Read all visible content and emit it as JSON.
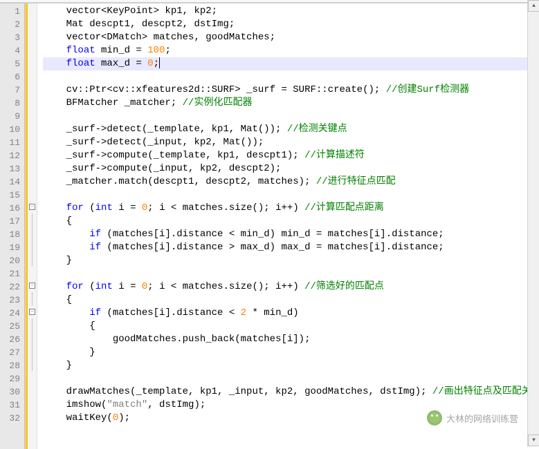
{
  "lineCount": 32,
  "currentLine": 5,
  "foldMarkers": {
    "16": "minus",
    "22": "minus",
    "24": "minus"
  },
  "foldLines": [
    17,
    18,
    19,
    20,
    23,
    25,
    26,
    27,
    28
  ],
  "code": {
    "l1": {
      "indent": "    ",
      "tokens": [
        [
          "t",
          "vector<KeyPoint> kp1, kp2;"
        ]
      ]
    },
    "l2": {
      "indent": "    ",
      "tokens": [
        [
          "t",
          "Mat descpt1, descpt2, dstImg;"
        ]
      ]
    },
    "l3": {
      "indent": "    ",
      "tokens": [
        [
          "t",
          "vector<DMatch> matches, goodMatches;"
        ]
      ]
    },
    "l4": {
      "indent": "    ",
      "tokens": [
        [
          "k",
          "float"
        ],
        [
          "t",
          " min_d = "
        ],
        [
          "n",
          "100"
        ],
        [
          "t",
          ";"
        ]
      ]
    },
    "l5": {
      "indent": "    ",
      "tokens": [
        [
          "k",
          "float"
        ],
        [
          "t",
          " max_d = "
        ],
        [
          "n",
          "0"
        ],
        [
          "t",
          ";"
        ]
      ],
      "cursor": true
    },
    "l6": {
      "indent": "",
      "tokens": []
    },
    "l7": {
      "indent": "    ",
      "tokens": [
        [
          "t",
          "cv::Ptr<cv::xfeatures2d::SURF> _surf = SURF::create(); "
        ],
        [
          "c",
          "//创建Surf检测器"
        ]
      ]
    },
    "l8": {
      "indent": "    ",
      "tokens": [
        [
          "t",
          "BFMatcher _matcher; "
        ],
        [
          "c",
          "//实例化匹配器"
        ]
      ]
    },
    "l9": {
      "indent": "",
      "tokens": []
    },
    "l10": {
      "indent": "    ",
      "tokens": [
        [
          "t",
          "_surf->detect(_template, kp1, Mat()); "
        ],
        [
          "c",
          "//检测关键点"
        ]
      ]
    },
    "l11": {
      "indent": "    ",
      "tokens": [
        [
          "t",
          "_surf->detect(_input, kp2, Mat());"
        ]
      ]
    },
    "l12": {
      "indent": "    ",
      "tokens": [
        [
          "t",
          "_surf->compute(_template, kp1, descpt1); "
        ],
        [
          "c",
          "//计算描述符"
        ]
      ]
    },
    "l13": {
      "indent": "    ",
      "tokens": [
        [
          "t",
          "_surf->compute(_input, kp2, descpt2);"
        ]
      ]
    },
    "l14": {
      "indent": "    ",
      "tokens": [
        [
          "t",
          "_matcher.match(descpt1, descpt2, matches); "
        ],
        [
          "c",
          "//进行特征点匹配"
        ]
      ]
    },
    "l15": {
      "indent": "",
      "tokens": []
    },
    "l16": {
      "indent": "    ",
      "tokens": [
        [
          "k",
          "for"
        ],
        [
          "t",
          " ("
        ],
        [
          "k",
          "int"
        ],
        [
          "t",
          " i = "
        ],
        [
          "n",
          "0"
        ],
        [
          "t",
          "; i < matches.size(); i++) "
        ],
        [
          "c",
          "//计算匹配点距离"
        ]
      ]
    },
    "l17": {
      "indent": "    ",
      "tokens": [
        [
          "t",
          "{"
        ]
      ]
    },
    "l18": {
      "indent": "        ",
      "tokens": [
        [
          "k",
          "if"
        ],
        [
          "t",
          " (matches[i].distance < min_d) min_d = matches[i].distance;"
        ]
      ]
    },
    "l19": {
      "indent": "        ",
      "tokens": [
        [
          "k",
          "if"
        ],
        [
          "t",
          " (matches[i].distance > max_d) max_d = matches[i].distance;"
        ]
      ]
    },
    "l20": {
      "indent": "    ",
      "tokens": [
        [
          "t",
          "}"
        ]
      ]
    },
    "l21": {
      "indent": "",
      "tokens": []
    },
    "l22": {
      "indent": "    ",
      "tokens": [
        [
          "k",
          "for"
        ],
        [
          "t",
          " ("
        ],
        [
          "k",
          "int"
        ],
        [
          "t",
          " i = "
        ],
        [
          "n",
          "0"
        ],
        [
          "t",
          "; i < matches.size(); i++) "
        ],
        [
          "c",
          "//筛选好的匹配点"
        ]
      ]
    },
    "l23": {
      "indent": "    ",
      "tokens": [
        [
          "t",
          "{"
        ]
      ]
    },
    "l24": {
      "indent": "        ",
      "tokens": [
        [
          "k",
          "if"
        ],
        [
          "t",
          " (matches[i].distance < "
        ],
        [
          "n",
          "2"
        ],
        [
          "t",
          " * min_d)"
        ]
      ]
    },
    "l25": {
      "indent": "        ",
      "tokens": [
        [
          "t",
          "{"
        ]
      ]
    },
    "l26": {
      "indent": "            ",
      "tokens": [
        [
          "t",
          "goodMatches.push_back(matches[i]);"
        ]
      ]
    },
    "l27": {
      "indent": "        ",
      "tokens": [
        [
          "t",
          "}"
        ]
      ]
    },
    "l28": {
      "indent": "    ",
      "tokens": [
        [
          "t",
          "}"
        ]
      ]
    },
    "l29": {
      "indent": "",
      "tokens": []
    },
    "l30": {
      "indent": "    ",
      "tokens": [
        [
          "t",
          "drawMatches(_template, kp1, _input, kp2, goodMatches, dstImg); "
        ],
        [
          "c",
          "//画出特征点及匹配关系"
        ]
      ]
    },
    "l31": {
      "indent": "    ",
      "tokens": [
        [
          "t",
          "imshow("
        ],
        [
          "s",
          "\"match\""
        ],
        [
          "t",
          ", dstImg);"
        ]
      ]
    },
    "l32": {
      "indent": "    ",
      "tokens": [
        [
          "t",
          "waitKey("
        ],
        [
          "n",
          "0"
        ],
        [
          "t",
          ");"
        ]
      ]
    }
  },
  "watermark": "大林的网络训练营",
  "scroll": {
    "up": "▲",
    "down": "▼"
  }
}
